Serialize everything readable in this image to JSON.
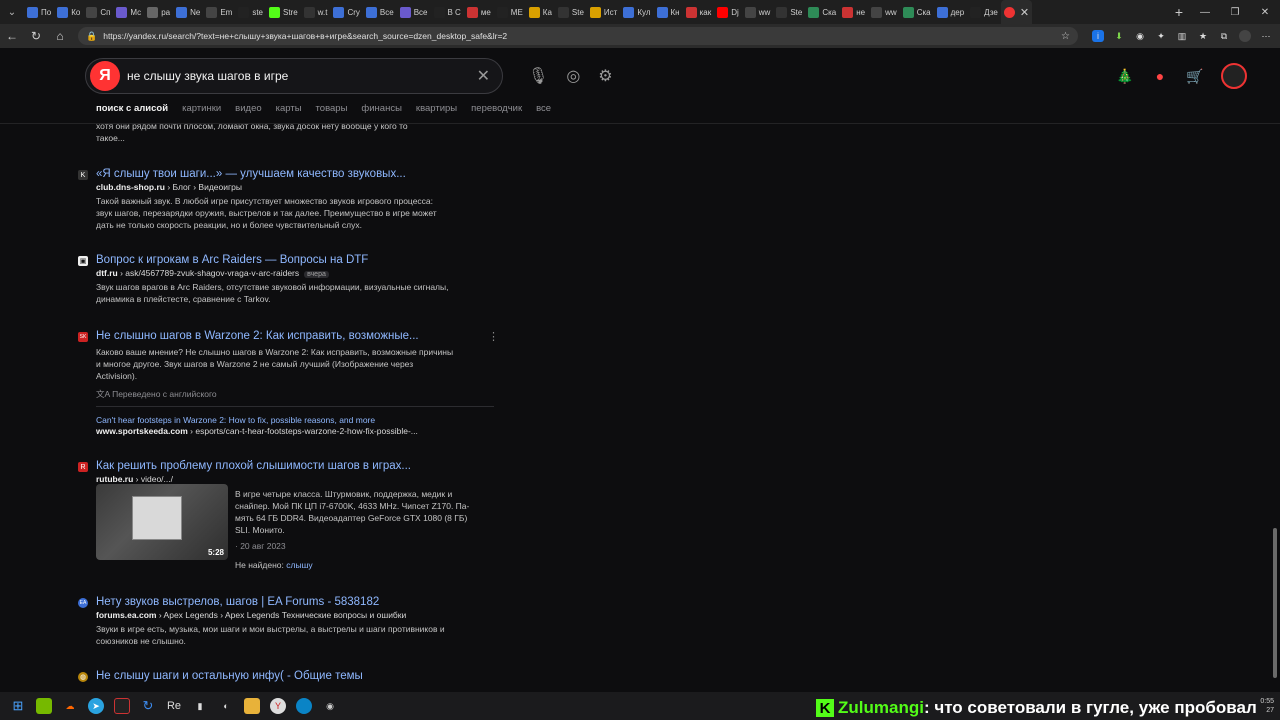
{
  "browser": {
    "tabs": [
      {
        "label": "По",
        "color": "#3d6fd6"
      },
      {
        "label": "Ко",
        "color": "#3d6fd6"
      },
      {
        "label": "Сп",
        "color": "#444"
      },
      {
        "label": "Мс",
        "color": "#6a5acd"
      },
      {
        "label": "ра",
        "color": "#666"
      },
      {
        "label": "Ne",
        "color": "#3d6fd6"
      },
      {
        "label": "Em",
        "color": "#444"
      },
      {
        "label": "ste",
        "color": "#222"
      },
      {
        "label": "Stre",
        "color": "#53fc18"
      },
      {
        "label": "w.t",
        "color": "#333"
      },
      {
        "label": "Cry",
        "color": "#3d6fd6"
      },
      {
        "label": "Все",
        "color": "#3d6fd6"
      },
      {
        "label": "Все",
        "color": "#6a5acd"
      },
      {
        "label": "В С",
        "color": "#222"
      },
      {
        "label": "ме",
        "color": "#c33"
      },
      {
        "label": "МЕ",
        "color": "#222"
      },
      {
        "label": "Ка",
        "color": "#d9a000"
      },
      {
        "label": "Ste",
        "color": "#333"
      },
      {
        "label": "Ист",
        "color": "#d9a000"
      },
      {
        "label": "Кул",
        "color": "#3d6fd6"
      },
      {
        "label": "Кн",
        "color": "#3d6fd6"
      },
      {
        "label": "как",
        "color": "#c33"
      },
      {
        "label": "Dj",
        "color": "#f00"
      },
      {
        "label": "ww",
        "color": "#444"
      },
      {
        "label": "Ste",
        "color": "#333"
      },
      {
        "label": "Ска",
        "color": "#2e8b57"
      },
      {
        "label": "не",
        "color": "#c33"
      },
      {
        "label": "ww",
        "color": "#444"
      },
      {
        "label": "Ска",
        "color": "#2e8b57"
      },
      {
        "label": "дер",
        "color": "#3d6fd6"
      },
      {
        "label": "Дзе",
        "color": "#222"
      }
    ],
    "active_tab_icon_color": "#e33",
    "url": "https://yandex.ru/search/?text=не+слышу+звука+шагов+в+игре&search_source=dzen_desktop_safe&lr=2"
  },
  "search": {
    "logo": "Я",
    "query": "не слышу звука шагов в игре"
  },
  "services": [
    "поиск с алисой",
    "картинки",
    "видео",
    "карты",
    "товары",
    "финансы",
    "квартиры",
    "переводчик",
    "все"
  ],
  "top_fade_text": [
    "хотя они рядом почти плосом, ломают окна, звука досок нету вообще у кого то",
    "такое..."
  ],
  "results": [
    {
      "icon": "K",
      "icon_color": "#333",
      "title": "«Я слышу твои шаги...» — улучшаем качество звуковых...",
      "path_domain": "club.dns-shop.ru",
      "path_rest": " › Блог › Видеоигры",
      "snippet": [
        "Такой важный звук. В любой игре присутствует множество звуков игрового процесса:",
        "звук шагов, перезарядки оружия, выстрелов и так далее. Преимущество в игре может",
        "дать не только скорость реакции, но и более чувствительный слух."
      ]
    },
    {
      "icon": "▣",
      "icon_color": "#eee",
      "title": "Вопрос к игрокам в Arc Raiders — Вопросы на DTF",
      "path_domain": "dtf.ru",
      "path_rest": " › ask/4567789-zvuk-shagov-vraga-v-arc-raiders",
      "badge": "вчера",
      "snippet": [
        "Звук шагов врагов в Arc Raiders, отсутствие звуковой информации, визуальные сигналы,",
        "динамика в плейстесте, сравнение с Tarkov."
      ]
    },
    {
      "icon": "SK",
      "icon_color": "#c22",
      "title": "Не слышно шагов в Warzone 2: Как исправить, возможные...",
      "snippet": [
        "Каково ваше мнение? Не слышно шагов в Warzone 2: Как исправить, возможные причины",
        "и многое другое. Звук шагов в Warzone 2 не самый лучший (Изображение через",
        "Activision)."
      ],
      "translated_note": "Переведено с английского",
      "orig_title": "Can't hear footsteps in Warzone 2: How to fix, possible reasons, and more",
      "path_domain": "www.sportskeeda.com",
      "path_rest": " › esports/can-t-hear-footsteps-warzone-2-how-fix-possible-..."
    },
    {
      "icon": "R",
      "icon_color": "#c22",
      "title": "Как решить проблему плохой слышимости шагов в играх...",
      "path_domain": "rutube.ru",
      "path_rest": " › video/.../",
      "duration": "5:28",
      "snippet": [
        "В игре четыре класса. Штурмовик, поддержка, медик и",
        "снайпер. Мой ПК ЦП i7-6700K, 4633 MHz. Чипсет Z170. Па-",
        "мять 64 ГБ DDR4. Видеоадаптер GeForce GTX 1080 (8 ГБ)",
        "SLI. Монито."
      ],
      "date": "· 20 авг 2023",
      "not_found_label": "Не найдено:",
      "not_found_word": "слышу"
    },
    {
      "icon": "EA",
      "icon_color": "#3d6fd6",
      "title": "Нету звуков выстрелов, шагов | EA Forums - 5838182",
      "path_domain": "forums.ea.com",
      "path_rest": " › Apex Legends › Apex Legends Технические вопросы и ошибки",
      "snippet": [
        "Звуки в игре есть, музыка, мои шаги и мои выстрелы, а выстрелы и шаги противников и",
        "союзников не слышно."
      ]
    },
    {
      "icon": "◍",
      "icon_color": "#b8860b",
      "title": "Не слышу шаги и остальную инфу( - Общие темы"
    }
  ],
  "taskbar": {
    "time": "0:55",
    "date": "27"
  },
  "chat": {
    "platform_letter": "K",
    "nick": "Zulumangi",
    "message": ": что советовали в гугле, уже пробовал"
  }
}
